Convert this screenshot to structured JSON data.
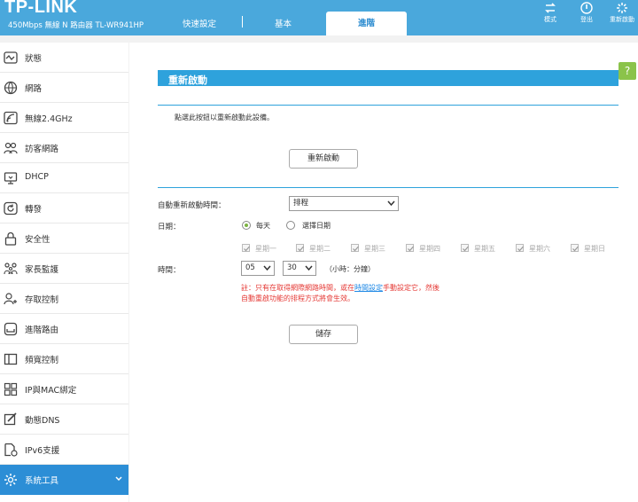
{
  "header": {
    "logo": "TP-LINK",
    "model": "450Mbps 無線 N 路由器 TL-WR941HP",
    "tabs": [
      {
        "label": "快速設定"
      },
      {
        "label": "基本"
      },
      {
        "label": "進階"
      }
    ],
    "active_tab": "進階",
    "buttons": [
      {
        "label": "模式",
        "icon": "swap-icon"
      },
      {
        "label": "登出",
        "icon": "power-icon"
      },
      {
        "label": "重新啟動",
        "icon": "reboot-icon"
      }
    ],
    "bg_color": "#4aa8dc"
  },
  "sidebar": {
    "items": [
      {
        "label": "狀態",
        "icon": "status-icon"
      },
      {
        "label": "網路",
        "icon": "globe-icon"
      },
      {
        "label": "無線2.4GHz",
        "icon": "wireless-icon"
      },
      {
        "label": "訪客網路",
        "icon": "guest-icon"
      },
      {
        "label": "DHCP",
        "icon": "dhcp-icon"
      },
      {
        "label": "轉發",
        "icon": "forwarding-icon"
      },
      {
        "label": "安全性",
        "icon": "lock-icon"
      },
      {
        "label": "家長監護",
        "icon": "parental-icon"
      },
      {
        "label": "存取控制",
        "icon": "access-control-icon"
      },
      {
        "label": "進階路由",
        "icon": "routing-icon"
      },
      {
        "label": "頻寬控制",
        "icon": "bandwidth-icon"
      },
      {
        "label": "IP與MAC綁定",
        "icon": "ip-mac-icon"
      },
      {
        "label": "動態DNS",
        "icon": "ddns-icon"
      },
      {
        "label": "IPv6支援",
        "icon": "ipv6-icon"
      },
      {
        "label": "系統工具",
        "icon": "gear-icon"
      }
    ],
    "active_item": "系統工具",
    "active_color": "#2c8ed6"
  },
  "main": {
    "help_label": "?",
    "section_title": "重新啟動",
    "description": "點選此按鈕以重新啟動此設備。",
    "reboot_button": "重新啟動",
    "schedule_label": "自動重新啟動時間：",
    "schedule_value": "排程",
    "date_label": "日期：",
    "radio_everyday": "每天",
    "radio_select_days": "選擇日期",
    "radio_selected": "每天",
    "weekdays": [
      {
        "label": "星期一",
        "checked": true
      },
      {
        "label": "星期二",
        "checked": true
      },
      {
        "label": "星期三",
        "checked": true
      },
      {
        "label": "星期四",
        "checked": true
      },
      {
        "label": "星期五",
        "checked": true
      },
      {
        "label": "星期六",
        "checked": true
      },
      {
        "label": "星期日",
        "checked": true
      }
    ],
    "time_label": "時間：",
    "hour_value": "05",
    "minute_value": "30",
    "time_hint": "（小時：分鐘）",
    "note_prefix": "註：只有在取得網際網路時間，或在",
    "note_link": "時間設定",
    "note_suffix": "手動設定它，然後",
    "note_line2": "自動重啟功能的排程方式將會生效。",
    "save_button": "儲存",
    "accent_color": "#2ea2dc",
    "note_color": "#e53935"
  }
}
